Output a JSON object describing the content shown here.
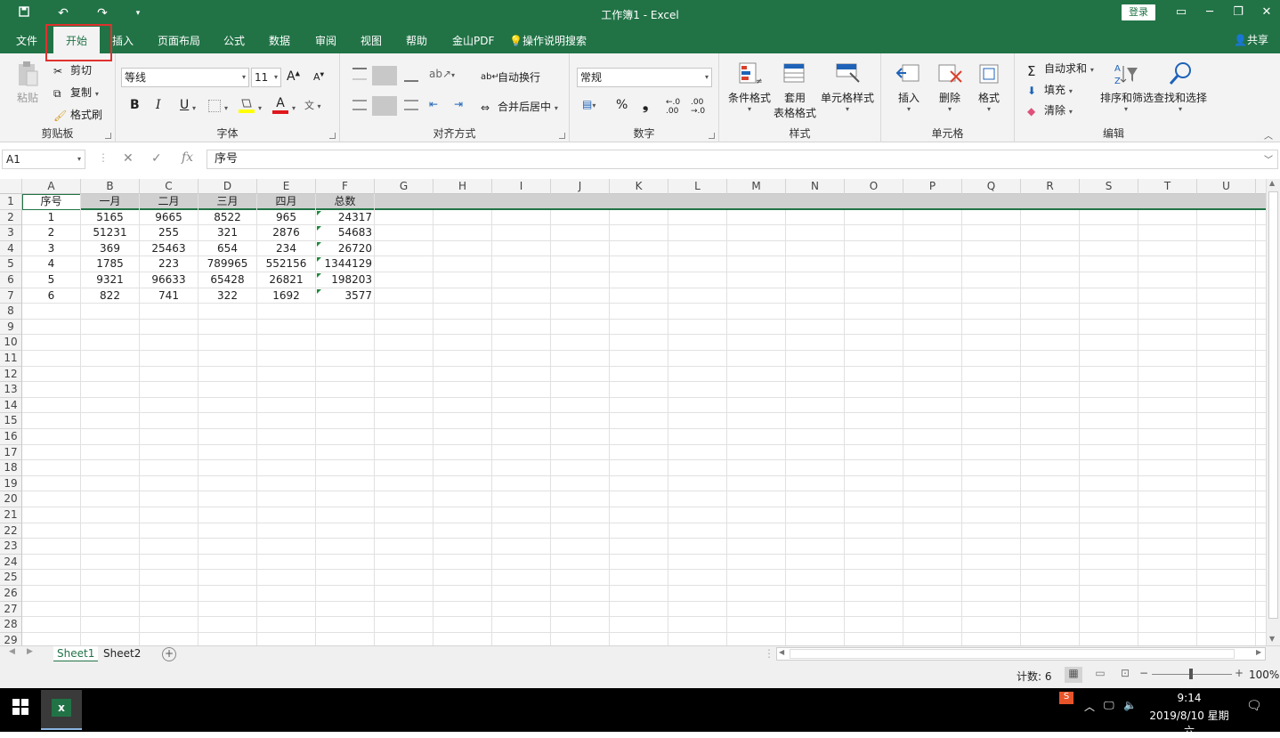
{
  "window": {
    "title": "工作簿1  -  Excel",
    "login": "登录",
    "share": "共享"
  },
  "tabs": [
    "文件",
    "开始",
    "插入",
    "页面布局",
    "公式",
    "数据",
    "审阅",
    "视图",
    "帮助",
    "金山PDF",
    "操作说明搜索"
  ],
  "ribbon": {
    "clipboard": {
      "label": "剪贴板",
      "paste": "粘贴",
      "cut": "剪切",
      "copy": "复制",
      "format_painter": "格式刷"
    },
    "font": {
      "label": "字体",
      "font_name": "等线",
      "font_size": "11",
      "bold": "B",
      "italic": "I",
      "underline": "U"
    },
    "alignment": {
      "label": "对齐方式",
      "wrap": "自动换行",
      "merge": "合并后居中"
    },
    "number": {
      "label": "数字",
      "format": "常规",
      "percent": "%",
      "comma": "❟"
    },
    "styles": {
      "label": "样式",
      "conditional": "条件格式",
      "table1": "套用",
      "table2": "表格格式",
      "cell_styles": "单元格样式"
    },
    "cells": {
      "label": "单元格",
      "insert": "插入",
      "delete": "删除",
      "format": "格式"
    },
    "editing": {
      "label": "编辑",
      "autosum": "自动求和",
      "fill": "填充",
      "clear": "清除",
      "sort": "排序和筛选",
      "find": "查找和选择"
    }
  },
  "formula_bar": {
    "name_box": "A1",
    "fx": "fx",
    "content": "序号"
  },
  "columns": [
    "A",
    "B",
    "C",
    "D",
    "E",
    "F",
    "G",
    "H",
    "I",
    "J",
    "K",
    "L",
    "M",
    "N",
    "O",
    "P",
    "Q",
    "R",
    "S",
    "T",
    "U"
  ],
  "rows": [
    "1",
    "2",
    "3",
    "4",
    "5",
    "6",
    "7",
    "8",
    "9",
    "10",
    "11",
    "12",
    "13",
    "14",
    "15",
    "16",
    "17",
    "18",
    "19",
    "20",
    "21",
    "22",
    "23",
    "24",
    "25",
    "26",
    "27",
    "28",
    "29"
  ],
  "table": {
    "header": [
      "序号",
      "一月",
      "二月",
      "三月",
      "四月",
      "总数"
    ],
    "data": [
      [
        "1",
        "5165",
        "9665",
        "8522",
        "965",
        "24317"
      ],
      [
        "2",
        "51231",
        "255",
        "321",
        "2876",
        "54683"
      ],
      [
        "3",
        "369",
        "25463",
        "654",
        "234",
        "26720"
      ],
      [
        "4",
        "1785",
        "223",
        "789965",
        "552156",
        "1344129"
      ],
      [
        "5",
        "9321",
        "96633",
        "65428",
        "26821",
        "198203"
      ],
      [
        "6",
        "822",
        "741",
        "322",
        "1692",
        "3577"
      ]
    ]
  },
  "sheets": [
    "Sheet1",
    "Sheet2"
  ],
  "status": {
    "count": "计数: 6",
    "zoom": "100%"
  },
  "taskbar": {
    "time": "9:14",
    "date": "2019/8/10 星期六"
  },
  "colors": {
    "brand": "#217346",
    "highlight": "#e0312f"
  }
}
